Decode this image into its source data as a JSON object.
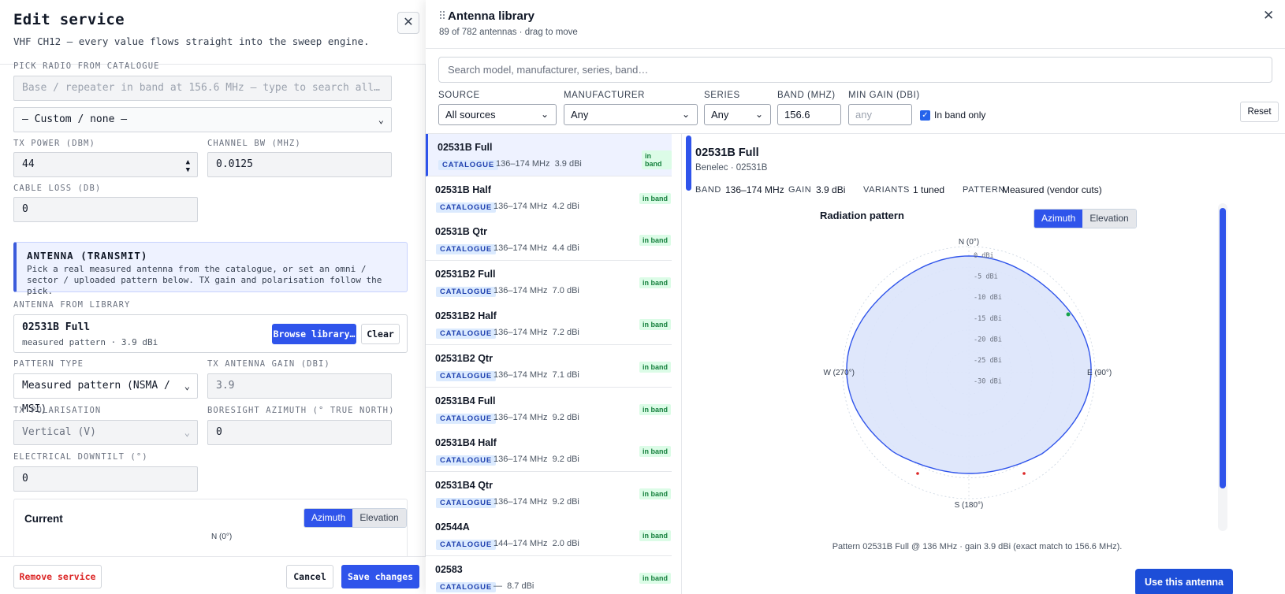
{
  "left": {
    "title": "Edit service",
    "subtitle": "VHF CH12 — every value flows straight into the sweep engine.",
    "pick_label": "PICK RADIO FROM CATALOGUE",
    "pick_placeholder": "Base / repeater in band at 156.6 MHz — type to search all…",
    "pick_select": "— Custom / none —",
    "tx_power_label": "TX POWER (DBM)",
    "tx_power_value": "44",
    "channel_bw_label": "CHANNEL BW (MHZ)",
    "channel_bw_value": "0.0125",
    "cable_loss_label": "CABLE LOSS (DB)",
    "cable_loss_value": "0",
    "antenna_note_title": "ANTENNA (TRANSMIT)",
    "antenna_note_text": "Pick a real measured antenna from the catalogue, or set an omni / sector / uploaded pattern below. TX gain and polarisation follow the pick.",
    "antenna_lib_label": "ANTENNA FROM LIBRARY",
    "antenna_lib_name": "02531B Full",
    "antenna_lib_desc": "measured pattern · 3.9 dBi",
    "browse_label": "Browse library…",
    "clear_label": "Clear",
    "pattern_type_label": "PATTERN TYPE",
    "pattern_type_value": "Measured pattern (NSMA / MSI)",
    "tx_gain_label": "TX ANTENNA GAIN (DBI)",
    "tx_gain_value": "3.9",
    "tx_pol_label": "TX POLARISATION",
    "tx_pol_value": "Vertical (V)",
    "boresight_label": "BORESIGHT AZIMUTH (° TRUE NORTH)",
    "boresight_value": "0",
    "downtilt_label": "ELECTRICAL DOWNTILT (°)",
    "downtilt_value": "0",
    "current_title": "Current",
    "azimuth_tab": "Azimuth",
    "elevation_tab": "Elevation",
    "current_n_label": "N (0°)",
    "remove_label": "Remove service",
    "cancel_label": "Cancel",
    "save_label": "Save changes"
  },
  "library": {
    "title": "Antenna library",
    "subtitle": "89 of 782 antennas · drag to move",
    "search_placeholder": "Search model, manufacturer, series, band…",
    "filters": {
      "source_label": "SOURCE",
      "source_value": "All sources",
      "manufacturer_label": "MANUFACTURER",
      "manufacturer_value": "Any",
      "series_label": "SERIES",
      "series_value": "Any",
      "band_label": "BAND (MHZ)",
      "band_value": "156.6",
      "min_gain_label": "MIN GAIN (DBI)",
      "min_gain_placeholder": "any",
      "in_band_label": "In band only",
      "reset_label": "Reset"
    },
    "items": [
      {
        "name": "02531B Full",
        "tag": "CATALOGUE",
        "band": "136–174 MHz",
        "gain": "3.9 dBi",
        "badge": "in band"
      },
      {
        "name": "02531B Half",
        "tag": "CATALOGUE",
        "band": "136–174 MHz",
        "gain": "4.2 dBi",
        "badge": "in band"
      },
      {
        "name": "02531B Qtr",
        "tag": "CATALOGUE",
        "band": "136–174 MHz",
        "gain": "4.4 dBi",
        "badge": "in band"
      },
      {
        "name": "02531B2 Full",
        "tag": "CATALOGUE",
        "band": "136–174 MHz",
        "gain": "7.0 dBi",
        "badge": "in band"
      },
      {
        "name": "02531B2 Half",
        "tag": "CATALOGUE",
        "band": "136–174 MHz",
        "gain": "7.2 dBi",
        "badge": "in band"
      },
      {
        "name": "02531B2 Qtr",
        "tag": "CATALOGUE",
        "band": "136–174 MHz",
        "gain": "7.1 dBi",
        "badge": "in band"
      },
      {
        "name": "02531B4 Full",
        "tag": "CATALOGUE",
        "band": "136–174 MHz",
        "gain": "9.2 dBi",
        "badge": "in band"
      },
      {
        "name": "02531B4 Half",
        "tag": "CATALOGUE",
        "band": "136–174 MHz",
        "gain": "9.2 dBi",
        "badge": "in band"
      },
      {
        "name": "02531B4 Qtr",
        "tag": "CATALOGUE",
        "band": "136–174 MHz",
        "gain": "9.2 dBi",
        "badge": "in band"
      },
      {
        "name": "02544A",
        "tag": "CATALOGUE",
        "band": "144–174 MHz",
        "gain": "2.0 dBi",
        "badge": "in band"
      },
      {
        "name": "02583",
        "tag": "CATALOGUE",
        "band": "—",
        "gain": "8.7 dBi",
        "badge": "in band"
      }
    ],
    "detail": {
      "name": "02531B Full",
      "manufacturer": "Benelec · 02531B",
      "band_key": "BAND",
      "band_val": "136–174 MHz",
      "gain_key": "GAIN",
      "gain_val": "3.9 dBi",
      "variants_key": "VARIANTS",
      "variants_val": "1 tuned",
      "pattern_key": "PATTERN",
      "pattern_val": "Measured (vendor cuts)",
      "pattern_title": "Radiation pattern",
      "azimuth_tab": "Azimuth",
      "elevation_tab": "Elevation",
      "caption": "Pattern 02531B Full @ 136 MHz · gain 3.9 dBi (exact match to 156.6 MHz).",
      "use_label": "Use this antenna"
    },
    "polar_labels": {
      "n": "N (0°)",
      "e": "E (90°)",
      "s": "S (180°)",
      "w": "W (270°)",
      "rings": [
        "0 dBi",
        "-5 dBi",
        "-10 dBi",
        "-15 dBi",
        "-20 dBi",
        "-25 dBi",
        "-30 dBi"
      ]
    }
  },
  "colors": {
    "accent": "#2f54eb",
    "pattern_fill": "#dbe4fb",
    "pattern_stroke": "#2f54eb",
    "in_band": "#15803d"
  }
}
